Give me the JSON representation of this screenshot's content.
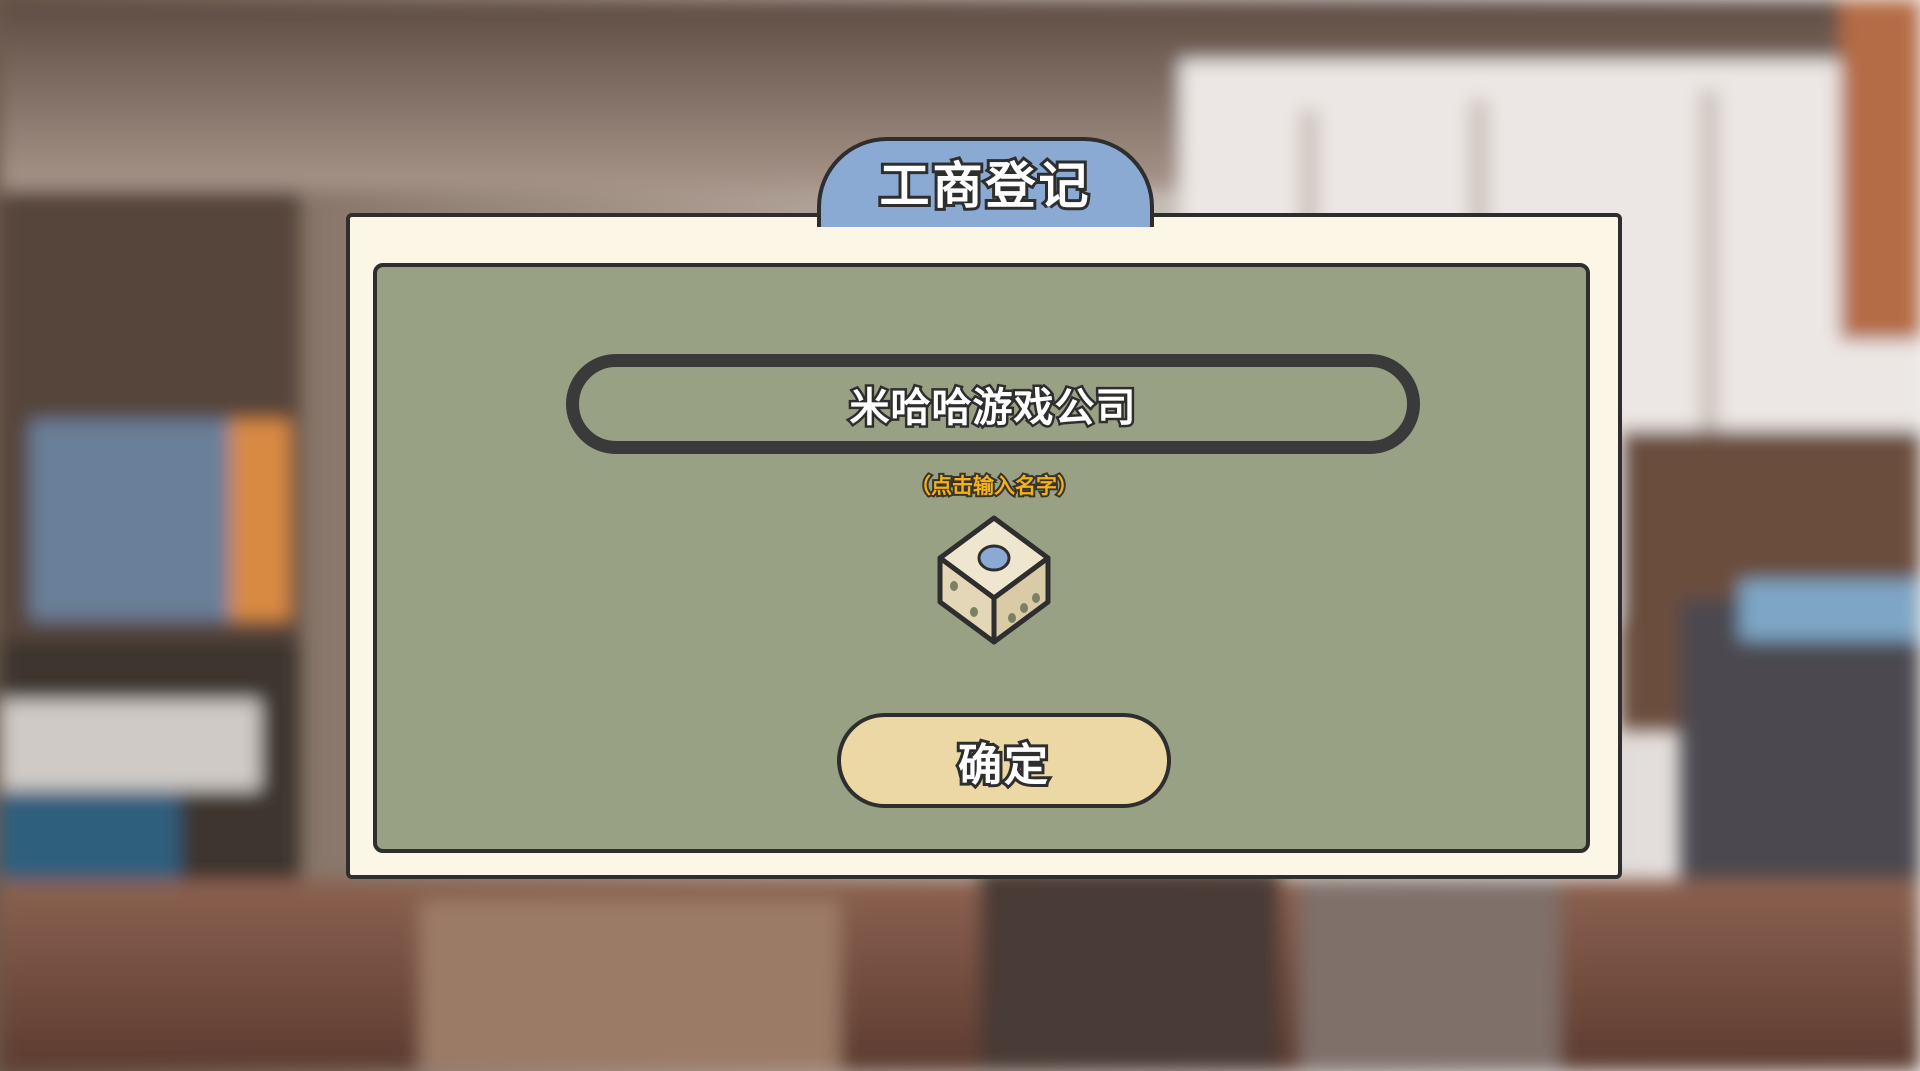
{
  "dialog": {
    "title": "工商登记",
    "company_name_value": "米哈哈游戏公司",
    "hint": "（点击输入名字）",
    "confirm_label": "确定"
  },
  "icons": {
    "random_name": "dice-icon"
  },
  "colors": {
    "title_tab": "#8aaad3",
    "frame": "#fbf6e6",
    "panel": "#99a184",
    "confirm_button": "#ecd8a5",
    "hint_text": "#f2b21c"
  }
}
